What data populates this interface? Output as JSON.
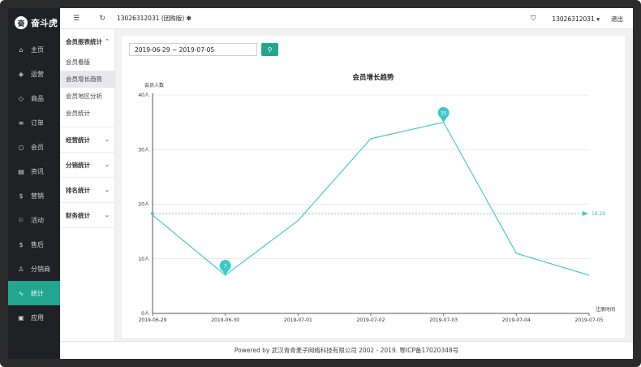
{
  "brand": {
    "logo_text": "奋斗虎"
  },
  "sidebar": {
    "items": [
      {
        "label": "主页",
        "icon": "home-icon",
        "glyph": "⌂",
        "active": false
      },
      {
        "label": "运营",
        "icon": "shield-icon",
        "glyph": "◈",
        "active": false
      },
      {
        "label": "商品",
        "icon": "tag-icon",
        "glyph": "◇",
        "active": false
      },
      {
        "label": "订单",
        "icon": "list-icon",
        "glyph": "≡",
        "active": false
      },
      {
        "label": "会员",
        "icon": "user-icon",
        "glyph": "○",
        "active": false
      },
      {
        "label": "资讯",
        "icon": "document-icon",
        "glyph": "▤",
        "active": false
      },
      {
        "label": "营销",
        "icon": "dollar-icon",
        "glyph": "$",
        "active": false
      },
      {
        "label": "活动",
        "icon": "flag-icon",
        "glyph": "⚐",
        "active": false
      },
      {
        "label": "售后",
        "icon": "dollar-circle-icon",
        "glyph": "$",
        "active": false
      },
      {
        "label": "分销商",
        "icon": "person-icon",
        "glyph": "♙",
        "active": false
      },
      {
        "label": "统计",
        "icon": "pulse-icon",
        "glyph": "∿",
        "active": true
      },
      {
        "label": "应用",
        "icon": "app-icon",
        "glyph": "▣",
        "active": false
      }
    ]
  },
  "submenu": {
    "groups": [
      {
        "label": "会员报表统计",
        "chevron": "⌃",
        "items": [
          {
            "label": "会员看版",
            "active": false
          },
          {
            "label": "会员增长趋势",
            "active": true
          },
          {
            "label": "会员地区分析",
            "active": false
          },
          {
            "label": "会员统计",
            "active": false
          }
        ]
      },
      {
        "label": "经营统计",
        "chevron": "⌄",
        "items": []
      },
      {
        "label": "分销统计",
        "chevron": "⌄",
        "items": []
      },
      {
        "label": "排名统计",
        "chevron": "⌄",
        "items": []
      },
      {
        "label": "财务统计",
        "chevron": "⌄",
        "items": []
      }
    ]
  },
  "topbar": {
    "menu_icon": "☰",
    "refresh_icon": "↻",
    "title": "13026312031 (团购版) ✽",
    "shirt_icon": "👕",
    "user": "13026312031 ▾",
    "logout": "退出"
  },
  "filter": {
    "date_range": "2019-06-29 ~ 2019-07-05",
    "search_icon": "⚲"
  },
  "chart_data": {
    "type": "line",
    "title": "会员增长趋势",
    "ylabel": "会员人数",
    "xlabel": "注册时间",
    "categories": [
      "2019-06-29",
      "2019-06-30",
      "2019-07-01",
      "2019-07-02",
      "2019-07-03",
      "2019-07-04",
      "2019-07-05"
    ],
    "values": [
      18,
      7,
      17,
      32,
      35,
      11,
      7
    ],
    "ylim": [
      0,
      40
    ],
    "yticks": [
      0,
      10,
      20,
      30,
      40
    ],
    "ytick_labels": [
      "0人",
      "10人",
      "20人",
      "30人",
      "40人"
    ],
    "average": 18.29,
    "average_label": "18.29",
    "max_label": "35",
    "min_label": "7",
    "max_index": 4,
    "min_index": 1,
    "line_color": "#3cc8c8",
    "grid": true
  },
  "footer": {
    "text": "Powered by 武汉青青麦子网络科技有限公司 2002 - 2019. 鄂ICP备17020348号"
  },
  "colors": {
    "accent": "#22a68f",
    "sidebar_bg": "#1f2124",
    "line": "#3cc8c8"
  }
}
